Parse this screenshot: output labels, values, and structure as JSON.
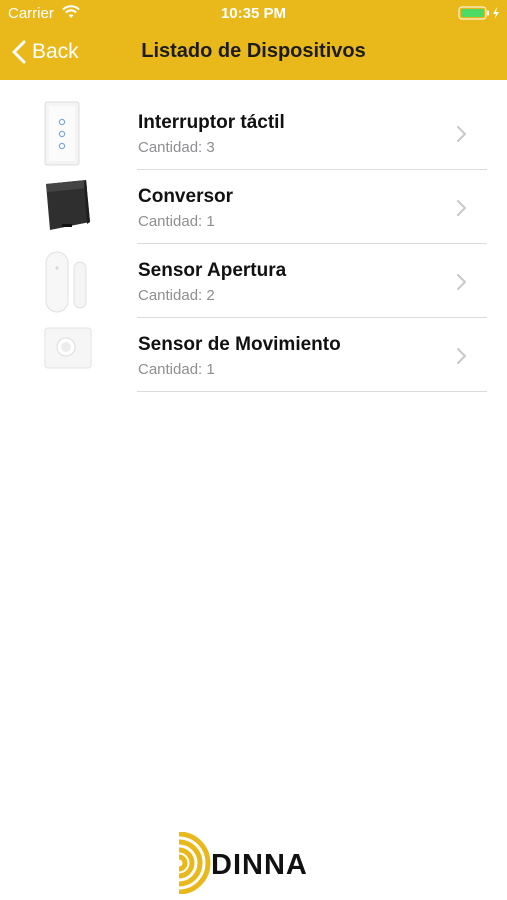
{
  "status_bar": {
    "carrier": "Carrier",
    "time": "10:35 PM",
    "icons": [
      "wifi-icon",
      "battery-icon",
      "charging-bolt-icon"
    ]
  },
  "nav": {
    "back_label": "Back",
    "title": "Listado de Dispositivos"
  },
  "devices": [
    {
      "name": "Interruptor táctil",
      "quantity": "Cantidad: 3",
      "icon": "touch-switch-icon"
    },
    {
      "name": "Conversor",
      "quantity": "Cantidad: 1",
      "icon": "converter-icon"
    },
    {
      "name": "Sensor Apertura",
      "quantity": "Cantidad: 2",
      "icon": "door-sensor-icon"
    },
    {
      "name": "Sensor de Movimiento",
      "quantity": "Cantidad: 1",
      "icon": "motion-sensor-icon"
    }
  ],
  "logo": {
    "text": "DINNA"
  },
  "colors": {
    "header": "#e9b91b",
    "title_text": "#1c1c1c",
    "secondary_text": "#8e8e93",
    "divider": "#dcdcdc",
    "chevron": "#c7c7cc",
    "logo_accent": "#e9b91b"
  }
}
